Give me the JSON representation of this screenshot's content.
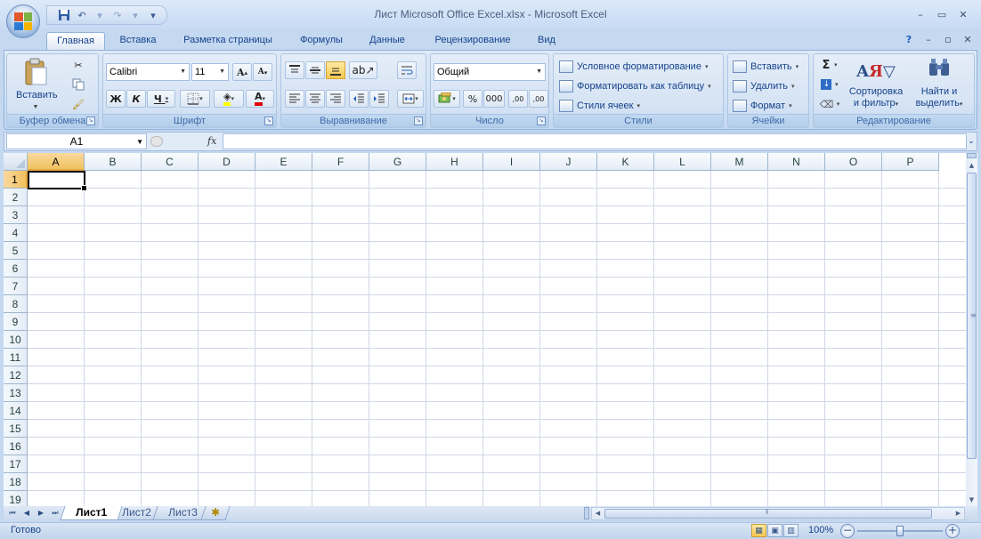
{
  "window": {
    "title": "Лист Microsoft Office Excel.xlsx - Microsoft Excel",
    "controls": {
      "minimize": "–",
      "maximize": "▭",
      "close": "✕"
    },
    "doc_controls": {
      "help": "?",
      "minimize": "–",
      "restore": "▫",
      "close": "✕"
    }
  },
  "qat": {
    "save_icon": "save-icon",
    "undo_icon": "undo-icon",
    "redo_icon": "redo-icon",
    "customize": "▾"
  },
  "tabs": [
    "Главная",
    "Вставка",
    "Разметка страницы",
    "Формулы",
    "Данные",
    "Рецензирование",
    "Вид"
  ],
  "ribbon": {
    "clipboard": {
      "label": "Буфер обмена",
      "paste": "Вставить"
    },
    "font": {
      "label": "Шрифт",
      "font_name": "Calibri",
      "font_size": "11",
      "bold": "Ж",
      "italic": "К",
      "underline": "Ч",
      "grow": "A",
      "shrink": "A",
      "font_color_letter": "A"
    },
    "alignment": {
      "label": "Выравнивание"
    },
    "number": {
      "label": "Число",
      "format": "Общий",
      "percent": "%",
      "thousands": "000",
      "inc_decimal": ",00",
      "dec_decimal": ",00"
    },
    "styles": {
      "label": "Стили",
      "conditional": "Условное форматирование",
      "as_table": "Форматировать как таблицу",
      "cell_styles": "Стили ячеек"
    },
    "cells": {
      "label": "Ячейки",
      "insert": "Вставить",
      "delete": "Удалить",
      "format": "Формат"
    },
    "editing": {
      "label": "Редактирование",
      "sigma": "Σ",
      "sort_line1": "Сортировка",
      "sort_line2": "и фильтр",
      "find_line1": "Найти и",
      "find_line2": "выделить"
    }
  },
  "formula_bar": {
    "name_box": "A1",
    "fx": "fx",
    "value": ""
  },
  "grid": {
    "columns": [
      "A",
      "B",
      "C",
      "D",
      "E",
      "F",
      "G",
      "H",
      "I",
      "J",
      "K",
      "L",
      "M",
      "N",
      "O",
      "P"
    ],
    "rows": [
      "1",
      "2",
      "3",
      "4",
      "5",
      "6",
      "7",
      "8",
      "9",
      "10",
      "11",
      "12",
      "13",
      "14",
      "15",
      "16",
      "17",
      "18",
      "19"
    ],
    "active_cell": "A1"
  },
  "sheets": {
    "tabs": [
      "Лист1",
      "Лист2",
      "Лист3"
    ],
    "active": "Лист1"
  },
  "status": {
    "ready": "Готово",
    "zoom": "100%",
    "zoom_minus": "−",
    "zoom_plus": "+"
  },
  "colors": {
    "accent": "#15428b",
    "selection": "#f1c15f",
    "ribbon": "#d2e1f3"
  }
}
